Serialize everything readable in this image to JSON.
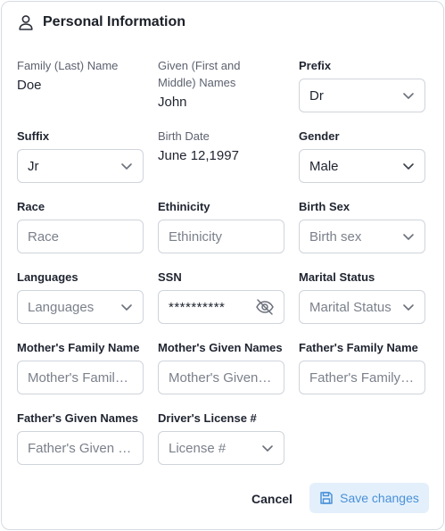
{
  "header": {
    "title": "Personal Information",
    "icon": "person-icon"
  },
  "fields": {
    "family_name": {
      "label": "Family (Last) Name",
      "value": "Doe"
    },
    "given_name": {
      "label_line1": "Given (First and",
      "label_line2": "Middle) Names",
      "value": "John"
    },
    "prefix": {
      "label": "Prefix",
      "value": "Dr"
    },
    "suffix": {
      "label": "Suffix",
      "value": "Jr"
    },
    "birth_date": {
      "label": "Birth Date",
      "value": "June 12,1997"
    },
    "gender": {
      "label": "Gender",
      "value": "Male"
    },
    "race": {
      "label": "Race",
      "placeholder": "Race"
    },
    "ethnicity": {
      "label": "Ethinicity",
      "placeholder": "Ethinicity"
    },
    "birth_sex": {
      "label": "Birth Sex",
      "placeholder": "Birth sex"
    },
    "languages": {
      "label": "Languages",
      "placeholder": "Languages"
    },
    "ssn": {
      "label": "SSN",
      "value": "**********"
    },
    "marital_status": {
      "label": "Marital Status",
      "placeholder": "Marital Status"
    },
    "mothers_family_name": {
      "label": "Mother's Family Name",
      "placeholder": "Mother's Family Name"
    },
    "mothers_given_names": {
      "label": "Mother's Given Names",
      "placeholder": "Mother's Given Names"
    },
    "fathers_family_name": {
      "label": "Father's Family Name",
      "placeholder": "Father's Family Name"
    },
    "fathers_given_names": {
      "label": "Father's Given Names",
      "placeholder": "Father's Given Names"
    },
    "drivers_license": {
      "label": "Driver's License #",
      "placeholder": "License #"
    }
  },
  "actions": {
    "cancel_label": "Cancel",
    "save_label": "Save changes"
  },
  "colors": {
    "accent": "#4a90d9",
    "save_bg": "#e3f0fb",
    "border": "#cfd4db"
  }
}
